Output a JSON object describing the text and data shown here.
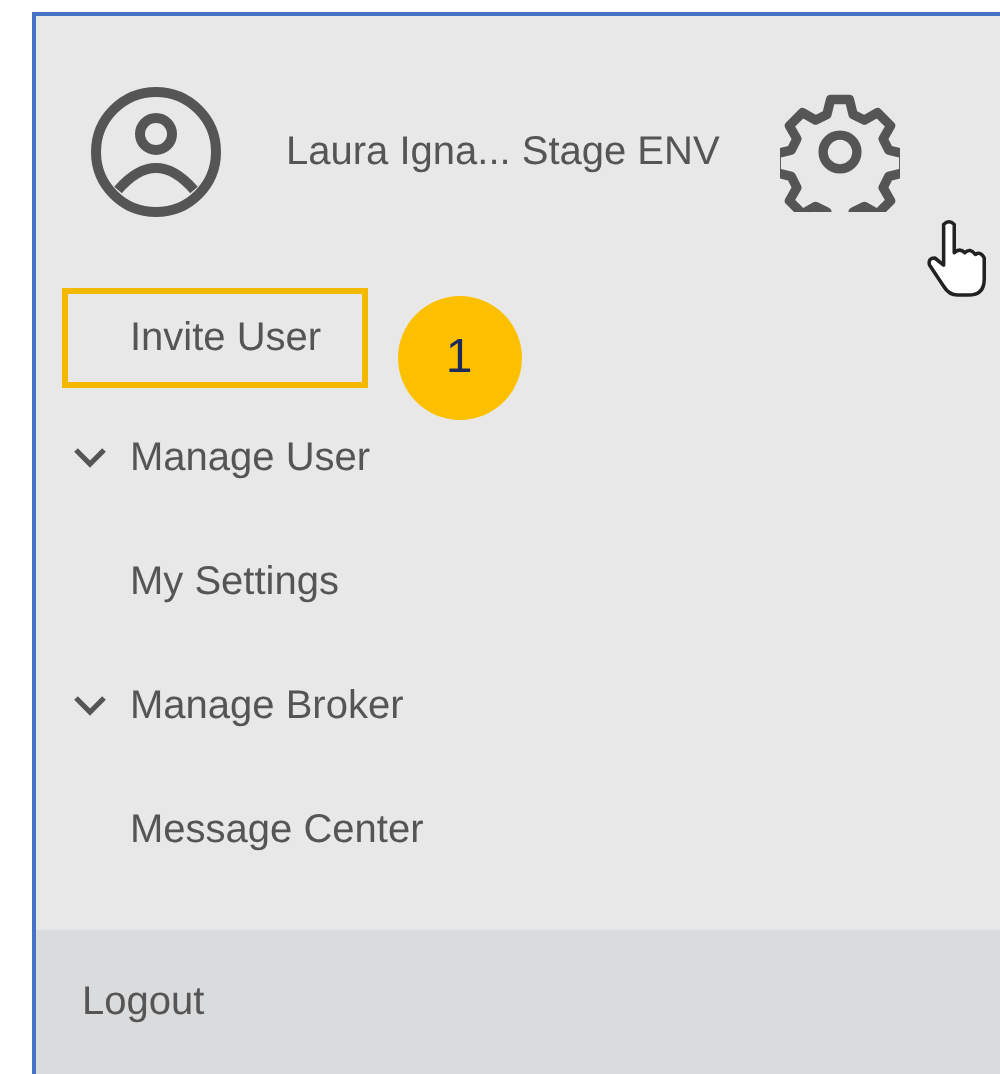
{
  "user": {
    "name": "Laura Igna... Stage ENV"
  },
  "menu": [
    {
      "label": "Invite User",
      "kind": "link",
      "highlighted": true,
      "callout": "1"
    },
    {
      "label": "Manage User",
      "kind": "group",
      "highlighted": false
    },
    {
      "label": "My Settings",
      "kind": "link",
      "highlighted": false
    },
    {
      "label": "Manage Broker",
      "kind": "group",
      "highlighted": false
    },
    {
      "label": "Message Center",
      "kind": "link",
      "highlighted": false
    }
  ],
  "logout": {
    "label": "Logout"
  }
}
